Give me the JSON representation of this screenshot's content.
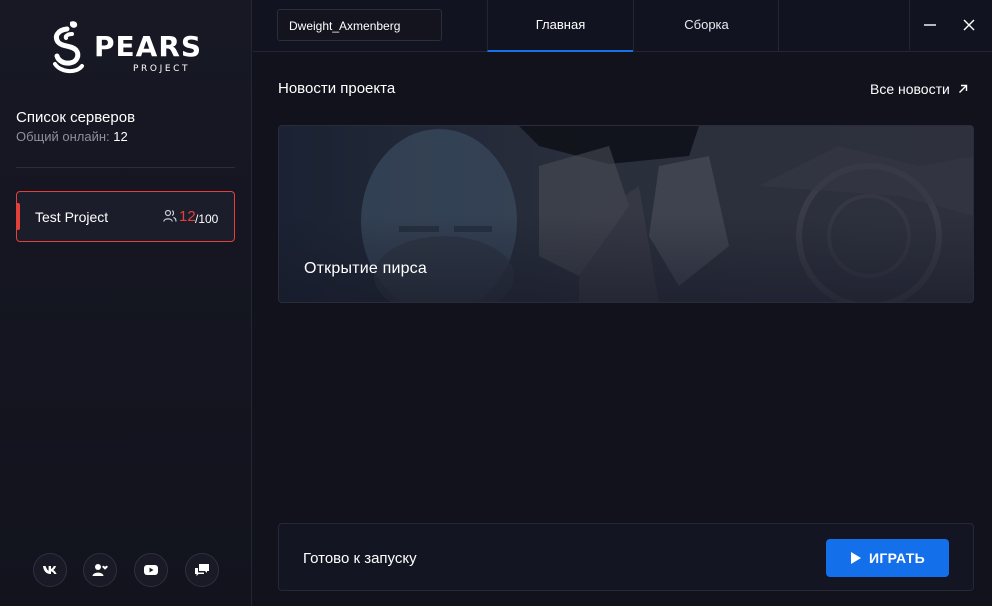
{
  "brand": {
    "name": "PEARS",
    "sub": "PROJECT"
  },
  "sidebar": {
    "title": "Список серверов",
    "online_label": "Общий онлайн:",
    "online_count": "12",
    "servers": [
      {
        "name": "Test Project",
        "online": "12",
        "max": "/100",
        "status_color": "#e3403c"
      }
    ],
    "social": [
      {
        "name": "vk-icon"
      },
      {
        "name": "user-heart-icon"
      },
      {
        "name": "youtube-icon"
      },
      {
        "name": "chat-icon"
      }
    ]
  },
  "topbar": {
    "username": "Dweight_Axmenberg",
    "tabs": [
      {
        "label": "Главная",
        "active": true
      },
      {
        "label": "Сборка",
        "active": false
      }
    ]
  },
  "news": {
    "title": "Новости проекта",
    "all_link": "Все новости",
    "items": [
      {
        "title": "Открытие пирса"
      }
    ]
  },
  "launch": {
    "status": "Готово к запуску",
    "play_label": "ИГРАТЬ"
  },
  "colors": {
    "accent": "#1470ea",
    "danger": "#e3403c",
    "background": "#11121c"
  }
}
